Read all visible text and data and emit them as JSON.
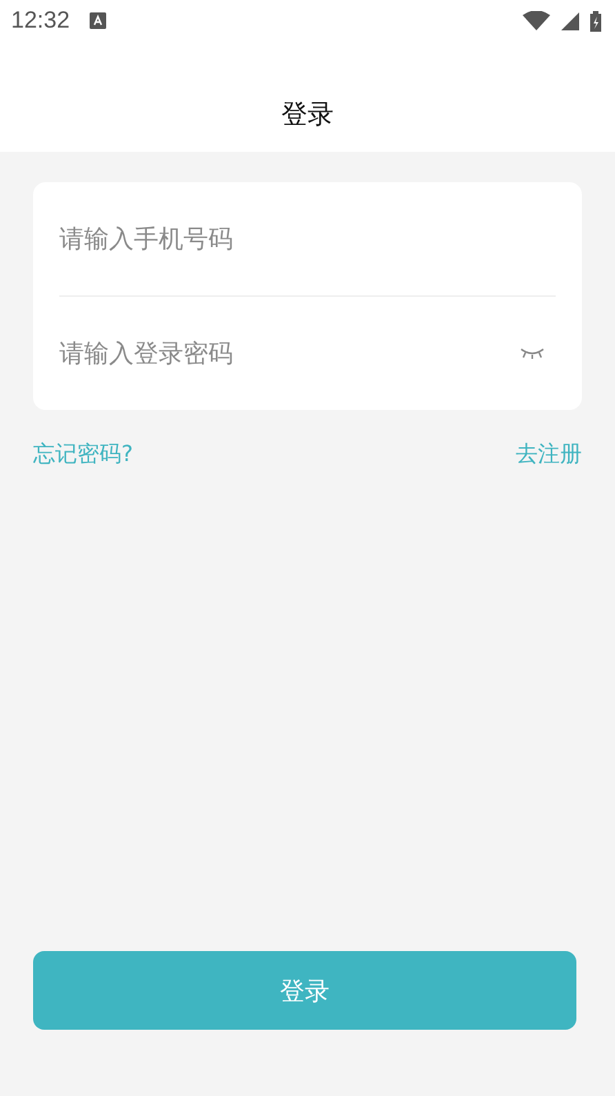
{
  "status_bar": {
    "time": "12:32"
  },
  "header": {
    "title": "登录"
  },
  "form": {
    "fields": [
      {
        "kind": "text",
        "placeholder": "请输入手机号码"
      },
      {
        "kind": "password",
        "placeholder": "请输入登录密码"
      }
    ]
  },
  "links": [
    "忘记密码?",
    "去注册"
  ],
  "submit": "登录"
}
